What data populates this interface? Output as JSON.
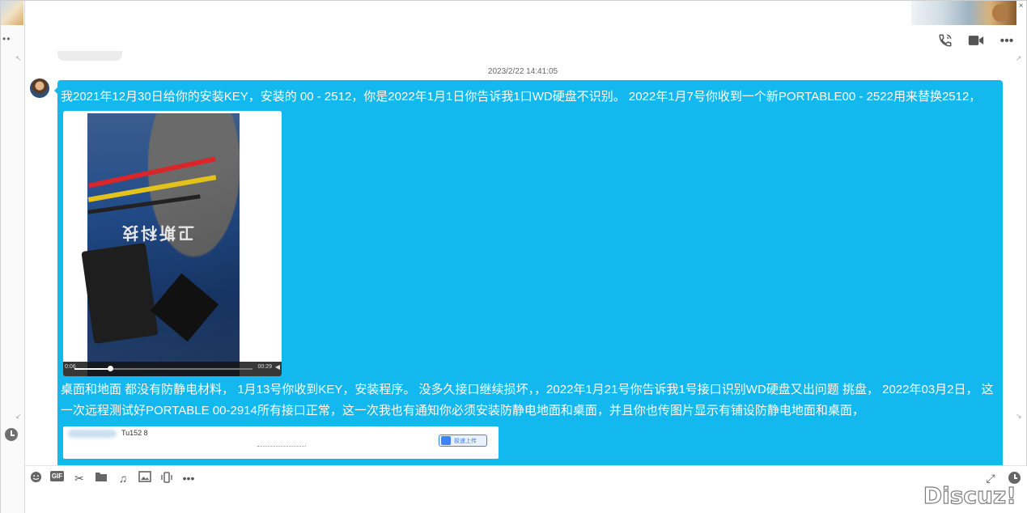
{
  "chat": {
    "timestamp": "2023/2/22 14:41:05",
    "message": {
      "text_part1": "我2021年12月30日给你的安装KEY，安装的 00 - 2512，你是2022年1月1日你告诉我1口WD硬盘不识别。  2022年1月7号你收到一个新PORTABLE00 - 2522用来替换2512，",
      "video": {
        "current_time": "0:06",
        "duration": "00:29",
        "progress": 0.2,
        "brand_text": "卫斯科技"
      },
      "text_part2": "桌面和地面 都没有防静电材料，  1月13号你收到KEY，安装程序。 没多久接口继续损坏，，2022年1月21号你告诉我1号接口识别WD硬盘又出问题 挑盘，   2022年03月2日，  这一次远程测试好PORTABLE 00-2914所有接口正常，这一次我也有通知你必须安装防静电地面和桌面，并且你也传图片显示有铺设防静电地面和桌面，",
      "screenshot": {
        "account_text": "Tu152         8",
        "upload_button_label": "极速上传"
      }
    }
  },
  "header": {
    "icons": [
      "phone-icon",
      "video-call-icon",
      "more-icon"
    ],
    "more_label": "•••"
  },
  "toolbar": {
    "icons": [
      "emoji-icon",
      "gif-icon",
      "scissors-icon",
      "folder-icon",
      "music-icon",
      "image-icon",
      "shake-icon",
      "more-icon"
    ],
    "gif_label": "GIF",
    "more_label": "•••"
  },
  "watermark": "Discuz!",
  "colors": {
    "bubble": "#12b8ee",
    "bubble_text": "#ffffff"
  }
}
